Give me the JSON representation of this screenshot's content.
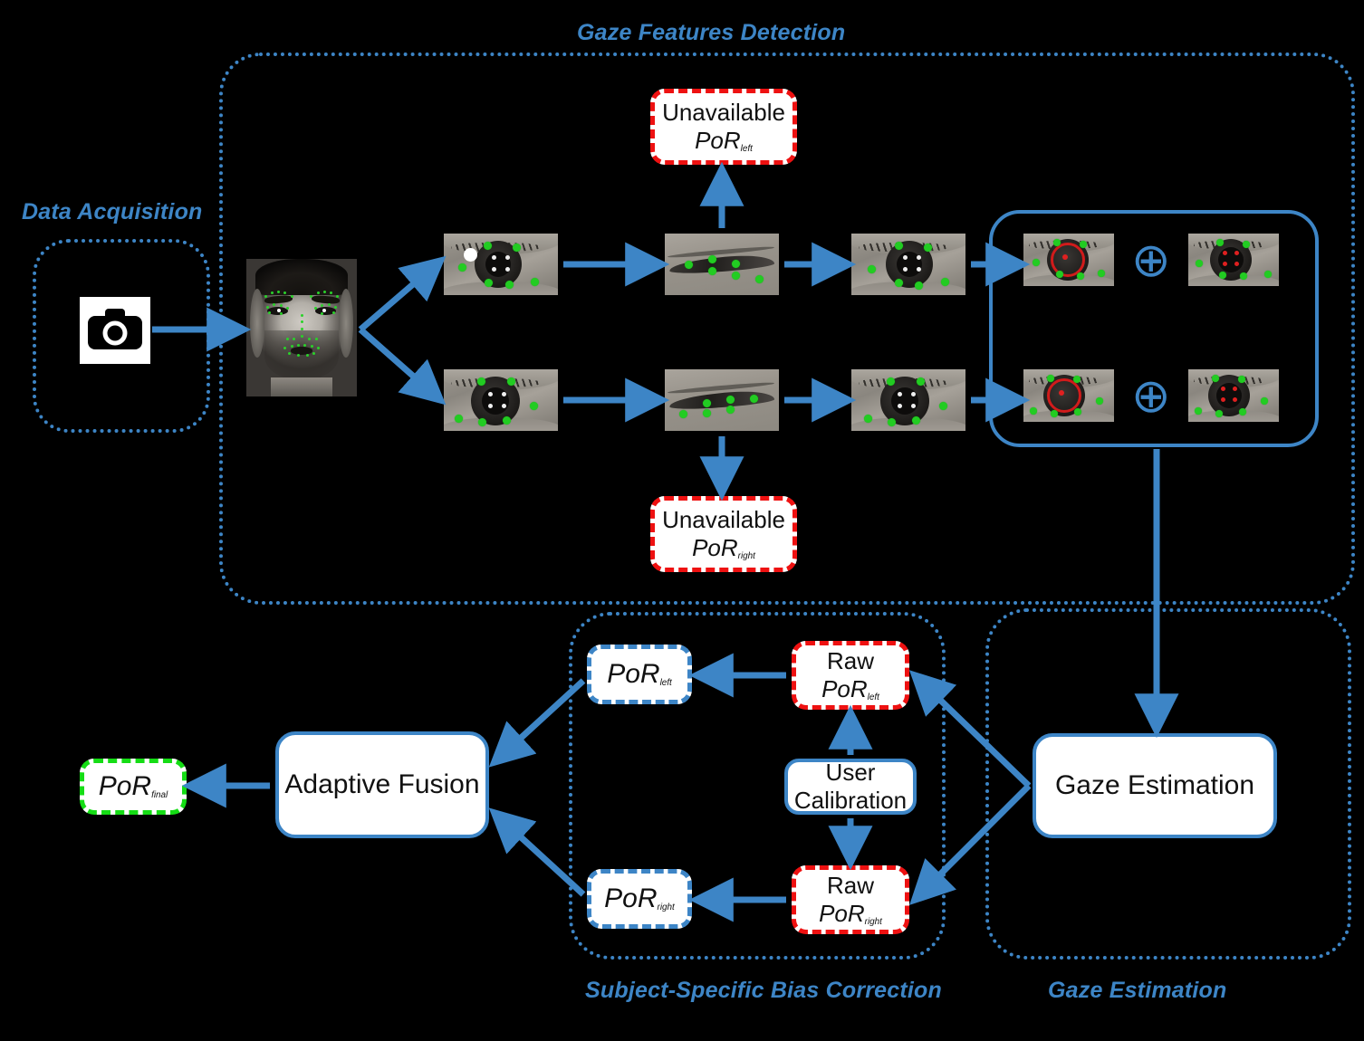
{
  "colors": {
    "accent_blue": "#3d85c6",
    "red_dashed": "#ee1111",
    "green_dashed": "#15dd15",
    "landmark_green": "#22cc22",
    "background": "#000000",
    "node_fill": "#ffffff"
  },
  "sections": {
    "data_acquisition": "Data Acquisition",
    "gaze_features_detection": "Gaze Features Detection",
    "subject_specific_bias_correction": "Subject-Specific Bias Correction",
    "gaze_estimation": "Gaze Estimation"
  },
  "nodes": {
    "camera": "camera-icon",
    "face_image": "face-landmarks-image",
    "unavailable_por_left": {
      "line1": "Unavailable",
      "sym": "PoR",
      "sub": "left"
    },
    "unavailable_por_right": {
      "line1": "Unavailable",
      "sym": "PoR",
      "sub": "right"
    },
    "por_left": {
      "sym": "PoR",
      "sub": "left"
    },
    "por_right": {
      "sym": "PoR",
      "sub": "right"
    },
    "raw_por_left": {
      "line1": "Raw",
      "sym": "PoR",
      "sub": "left"
    },
    "raw_por_right": {
      "line1": "Raw",
      "sym": "PoR",
      "sub": "right"
    },
    "por_final": {
      "sym": "PoR",
      "sub": "final"
    },
    "user_calibration": {
      "line1": "User",
      "line2": "Calibration"
    },
    "adaptive_fusion": "Adaptive Fusion",
    "gaze_estimation_box": "Gaze Estimation",
    "combine_symbol": "⊕"
  },
  "pipeline": {
    "left_row": [
      "eye-open-landmarks",
      "eye-closed-landmarks",
      "eye-open-landmarks",
      "eye-iris-fit",
      "eye-pupil-center"
    ],
    "right_row": [
      "eye-open-landmarks",
      "eye-closed-landmarks",
      "eye-open-landmarks",
      "eye-iris-fit",
      "eye-pupil-center"
    ]
  }
}
